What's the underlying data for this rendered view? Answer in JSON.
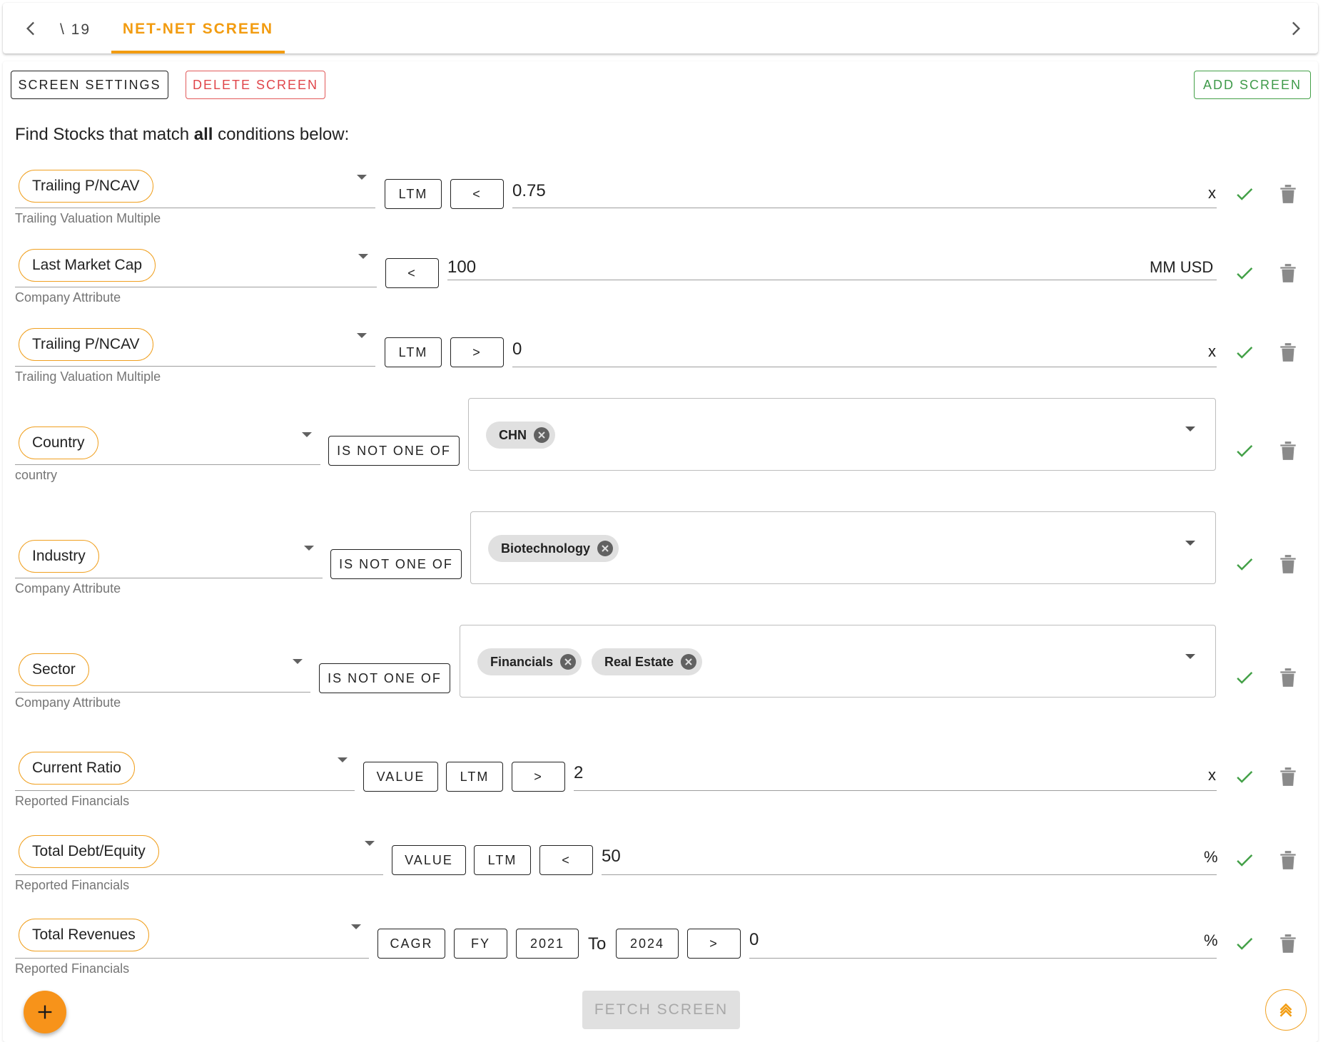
{
  "tabs": {
    "previous_label": "\\ 19",
    "active_label": "NET-NET SCREEN"
  },
  "toolbar": {
    "settings_label": "SCREEN SETTINGS",
    "delete_label": "DELETE SCREEN",
    "add_label": "ADD SCREEN"
  },
  "heading": {
    "prefix": "Find Stocks that match ",
    "emphasis": "all",
    "suffix": " conditions below:"
  },
  "conditions": [
    {
      "metric": "Trailing P/NCAV",
      "category": "Trailing Valuation Multiple",
      "period": "LTM",
      "operator": "<",
      "value": "0.75",
      "unit": "x"
    },
    {
      "metric": "Last Market Cap",
      "category": "Company Attribute",
      "operator": "<",
      "value": "100",
      "unit": "MM USD"
    },
    {
      "metric": "Trailing P/NCAV",
      "category": "Trailing Valuation Multiple",
      "period": "LTM",
      "operator": ">",
      "value": "0",
      "unit": "x"
    },
    {
      "metric": "Country",
      "category": "country",
      "operator": "IS NOT ONE OF",
      "selected": [
        "CHN"
      ]
    },
    {
      "metric": "Industry",
      "category": "Company Attribute",
      "operator": "IS NOT ONE OF",
      "selected": [
        "Biotechnology"
      ]
    },
    {
      "metric": "Sector",
      "category": "Company Attribute",
      "operator": "IS NOT ONE OF",
      "selected": [
        "Financials",
        "Real Estate"
      ]
    },
    {
      "metric": "Current Ratio",
      "category": "Reported Financials",
      "mode": "VALUE",
      "period": "LTM",
      "operator": ">",
      "value": "2",
      "unit": "x"
    },
    {
      "metric": "Total Debt/Equity",
      "category": "Reported Financials",
      "mode": "VALUE",
      "period": "LTM",
      "operator": "<",
      "value": "50",
      "unit": "%"
    },
    {
      "metric": "Total Revenues",
      "category": "Reported Financials",
      "mode": "CAGR",
      "period": "FY",
      "from_year": "2021",
      "to_label": "To",
      "to_year": "2024",
      "operator": ">",
      "value": "0",
      "unit": "%"
    }
  ],
  "footer": {
    "fetch_label": "FETCH SCREEN"
  },
  "icons": {
    "prev": "chevron-left-icon",
    "next": "chevron-right-icon",
    "confirm": "check-icon",
    "delete": "trash-icon",
    "remove_chip": "cancel-circle-icon",
    "add": "plus-icon",
    "scroll_top": "double-chevron-up-icon"
  },
  "colors": {
    "accent": "#f29c11",
    "danger": "#e0454a",
    "success": "#43a047",
    "fab": "#f7931a"
  }
}
